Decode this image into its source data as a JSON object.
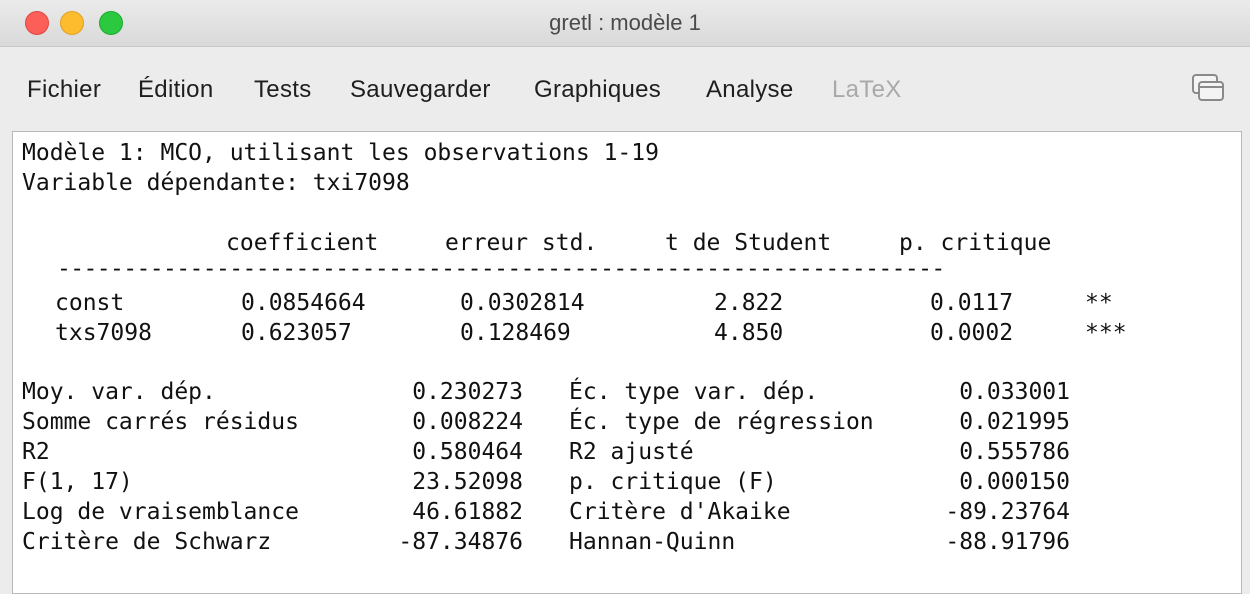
{
  "window": {
    "title": "gretl : modèle 1"
  },
  "menubar": {
    "items": [
      {
        "label": "Fichier",
        "enabled": true
      },
      {
        "label": "Édition",
        "enabled": true
      },
      {
        "label": "Tests",
        "enabled": true
      },
      {
        "label": "Sauvegarder",
        "enabled": true
      },
      {
        "label": "Graphiques",
        "enabled": true
      },
      {
        "label": "Analyse",
        "enabled": true
      },
      {
        "label": "LaTeX",
        "enabled": false
      }
    ]
  },
  "output": {
    "header_line1": "Modèle 1: MCO, utilisant les observations 1-19",
    "header_line2": "Variable dépendante: txi7098",
    "columns": [
      "coefficient",
      "erreur std.",
      "t de Student",
      "p. critique"
    ],
    "rule": "-------------------------------------------------------------------",
    "rows": [
      {
        "name": "const",
        "coef": "0.0854664",
        "se": "0.0302814",
        "t": "2.822",
        "p": "0.0117",
        "stars": "**"
      },
      {
        "name": "txs7098",
        "coef": "0.623057",
        "se": "0.128469",
        "t": "4.850",
        "p": "0.0002",
        "stars": "***"
      }
    ],
    "stats": [
      {
        "l_label": "Moy. var. dép.",
        "l_value": "0.230273",
        "r_label": "Éc. type var. dép.",
        "r_value": "0.033001"
      },
      {
        "l_label": "Somme carrés résidus",
        "l_value": "0.008224",
        "r_label": "Éc. type de régression",
        "r_value": "0.021995"
      },
      {
        "l_label": "R2",
        "l_value": "0.580464",
        "r_label": "R2 ajusté",
        "r_value": "0.555786"
      },
      {
        "l_label": "F(1, 17)",
        "l_value": "23.52098",
        "r_label": "p. critique (F)",
        "r_value": "0.000150"
      },
      {
        "l_label": "Log de vraisemblance",
        "l_value": "46.61882",
        "r_label": "Critère d'Akaike",
        "r_value": "-89.23764"
      },
      {
        "l_label": "Critère de Schwarz",
        "l_value": "-87.34876",
        "r_label": "Hannan-Quinn",
        "r_value": "-88.91796"
      }
    ]
  }
}
